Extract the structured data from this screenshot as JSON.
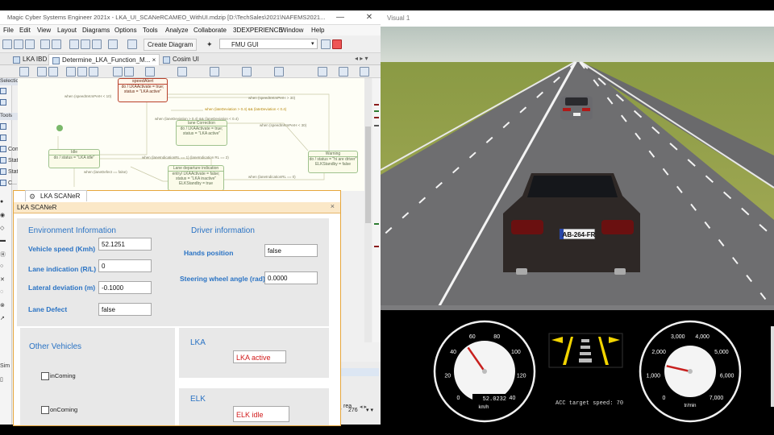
{
  "ide": {
    "title": "Magic Cyber Systems Engineer 2021x - LKA_UI_SCANeRCAMEO_WithUI.mdzip [D:\\TechSales\\2021\\NAFEMS2021...",
    "menu": [
      "File",
      "Edit",
      "View",
      "Layout",
      "Diagrams",
      "Options",
      "Tools",
      "Analyze",
      "Collaborate",
      "3DEXPERIENCE",
      "Window",
      "Help"
    ],
    "create_diagram": "Create Diagram",
    "fmu_select": "FMU GUI",
    "tabs": [
      "LKA IBD",
      "Determine_LKA_Function_M...",
      "Cosim UI"
    ],
    "palette_headers": [
      "Selection",
      "Tools"
    ],
    "palette_items": [
      "Com...",
      "State...",
      "State",
      "C..."
    ],
    "zoom_value": "276",
    "bottom_labels": [
      "Sim",
      "rea"
    ],
    "diagram": {
      "speed_alert_title": "speedAlert",
      "speed_alert_body": "do / LKAActivate = true; status = \"LKA active\"",
      "idle_title": "Idle",
      "idle_body": "do / status = \"LKA idle\"",
      "lane_correction_title": "lane Correction",
      "lane_correction_body": "do / LKAActivate = true; status = \"LKA active\"",
      "warning_title": "Warning",
      "warning_body": "do / status = \"hi are driver\" ELKStandby = false",
      "departure_title": "Lane departure indication",
      "departure_body": "entry/ LKAActivate = false; status = \"LKA inactive\" ELKStandby = true",
      "t1": "when (speedInKmPerH < 10)",
      "t2": "when (speedInKmPerH > 30)",
      "t3": "when (lateDeviation > 0.4) && (lateDeviation < 0.4)",
      "t4": "when (laneDeviation > 0.4) && (laneDeviation < 0.4)",
      "t5": "when (speedInKmPerH < 30)",
      "t6": "when (laneIndicationRL == 1) (laneIndication RL == 2)",
      "t7": "when (laneDefect == false)",
      "t8": "when (laneIndicationRL == 0)"
    }
  },
  "lka": {
    "tab_label": "LKA SCANeR",
    "header": "LKA SCANeR",
    "env_title": "Environment Information",
    "driver_title": "Driver information",
    "vehicle_speed_label": "Vehicle speed (Kmh)",
    "vehicle_speed_value": "52.1251",
    "lane_indication_label": "Lane indication (R/L)",
    "lane_indication_value": "0",
    "lateral_deviation_label": "Lateral deviation (m)",
    "lateral_deviation_value": "-0.1000",
    "lane_defect_label": "Lane Defect",
    "lane_defect_value": "false",
    "hands_position_label": "Hands position",
    "hands_position_value": "false",
    "steering_label": "Steering wheel angle (rad)",
    "steering_value": "0.0000",
    "other_vehicles_title": "Other Vehicles",
    "incoming_label": "inComing",
    "incoming_checked": false,
    "oncoming_label": "onComing",
    "oncoming_checked": false,
    "lka_title": "LKA",
    "lka_status": "LKA active",
    "elk_title": "ELK",
    "elk_status": "ELK idle"
  },
  "sim": {
    "title": "Visual 1",
    "plate": "AB-264-FR",
    "speedometer": {
      "ticks": [
        "0",
        "20",
        "40",
        "60",
        "80",
        "100",
        "120",
        "140"
      ],
      "readout": "52.0232",
      "unit": "km/h",
      "value": 52.0232,
      "max": 140
    },
    "tachometer": {
      "ticks": [
        "0",
        "1,000",
        "2,000",
        "3,000",
        "4,000",
        "5,000",
        "6,000",
        "7,000"
      ],
      "unit": "tr/min",
      "value": 1500,
      "max": 7000
    },
    "acc_label": "ACC target speed: 70",
    "accent_needle": "#c8201e",
    "lane_indicator_color": "#f2d400"
  }
}
